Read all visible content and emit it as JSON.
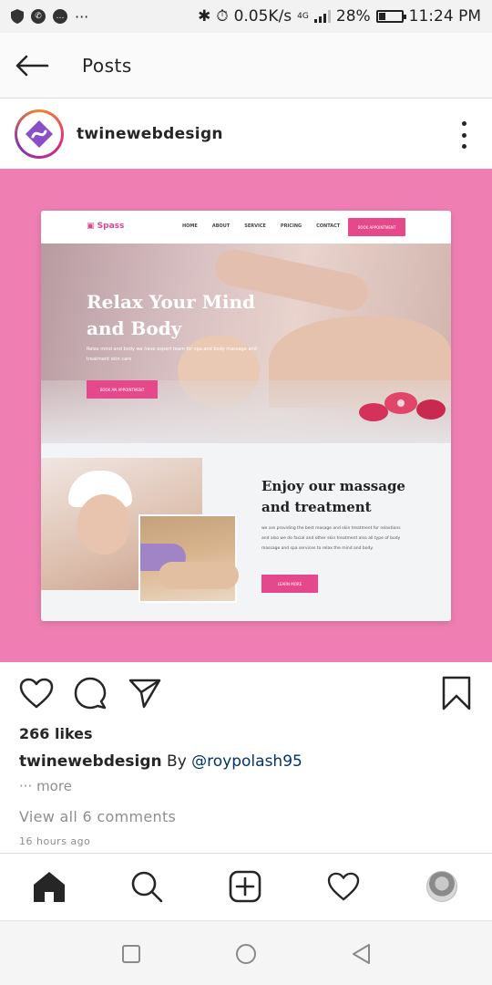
{
  "status_bar": {
    "network_speed": "0.05K/s",
    "network_type": "4G",
    "battery_percent": "28%",
    "battery_level": 0.28,
    "time": "11:24 PM",
    "more_indicator": "···"
  },
  "header": {
    "title": "Posts",
    "back_icon": "arrow-left-icon"
  },
  "post": {
    "username": "twinewebdesign",
    "avatar_icon": "twine-logo-icon",
    "menu_icon": "more-vertical-icon"
  },
  "mockup": {
    "logo": "Spass",
    "nav_links": [
      "HOME",
      "ABOUT",
      "SERVICE",
      "PRICING",
      "CONTACT"
    ],
    "cta": "BOOK APPOINTMENT",
    "hero_title": "Relax Your Mind and Body",
    "hero_subtitle": "Relax mind and body we have expert team for spa and body massage and treatment skin care",
    "hero_button": "BOOK AN APPOINTMENT",
    "section_title": "Enjoy our massage and treatment",
    "section_text": "we are providing the best masage and skin treatment for relaxtions and also we do facial and other skin treatment also all type of body massage and spa services to relax the mind and body.",
    "section_button": "LEARN MORE"
  },
  "actions": {
    "like_icon": "heart-icon",
    "comment_icon": "comment-icon",
    "share_icon": "send-icon",
    "save_icon": "bookmark-icon"
  },
  "engagement": {
    "likes": "266 likes",
    "caption_user": "twinewebdesign",
    "caption_text": " By ",
    "caption_mention": "@roypolash95",
    "more": "··· more",
    "view_comments": "View all 6 comments",
    "time_ago": "16 hours ago"
  },
  "bottom_nav": {
    "items": [
      "home-icon",
      "search-icon",
      "add-post-icon",
      "activity-heart-icon",
      "profile-avatar"
    ]
  },
  "system_nav": {
    "items": [
      "recents-square-icon",
      "home-circle-icon",
      "back-triangle-icon"
    ]
  },
  "colors": {
    "accent_pink": "#ef7fb2",
    "mockup_button": "#e5498b",
    "mention": "#003569",
    "muted": "#8e8e8e"
  }
}
